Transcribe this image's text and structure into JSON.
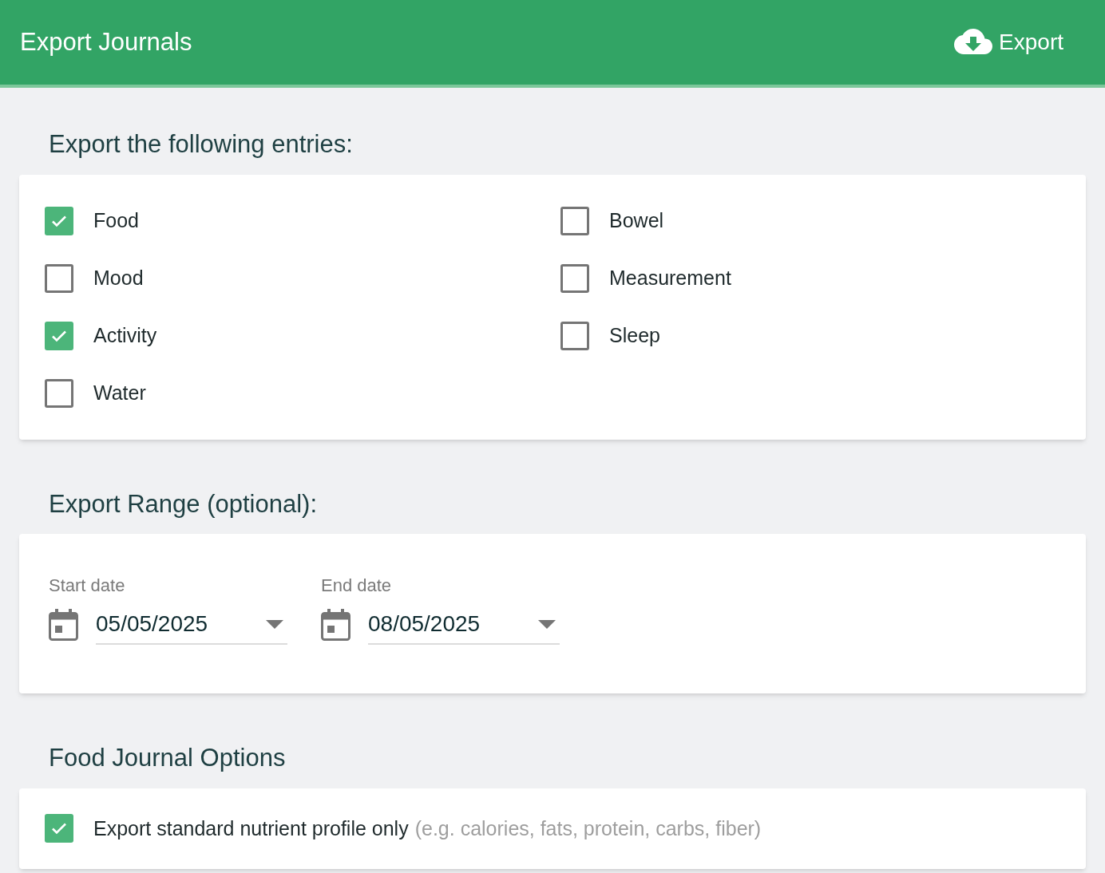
{
  "header": {
    "title": "Export Journals",
    "export_button": "Export"
  },
  "entries": {
    "heading": "Export the following entries:",
    "columns": [
      [
        {
          "label": "Food",
          "checked": true
        },
        {
          "label": "Mood",
          "checked": false
        },
        {
          "label": "Activity",
          "checked": true
        },
        {
          "label": "Water",
          "checked": false
        }
      ],
      [
        {
          "label": "Bowel",
          "checked": false
        },
        {
          "label": "Measurement",
          "checked": false
        },
        {
          "label": "Sleep",
          "checked": false
        }
      ]
    ]
  },
  "range": {
    "heading": "Export Range (optional):",
    "fields": [
      {
        "label": "Start date",
        "value": "05/05/2025"
      },
      {
        "label": "End date",
        "value": "08/05/2025"
      }
    ]
  },
  "food_options": {
    "heading": "Food Journal Options",
    "options": [
      {
        "label": "Export standard nutrient profile only",
        "hint": "(e.g. calories, fats, protein, carbs, fiber)",
        "checked": true
      }
    ]
  }
}
